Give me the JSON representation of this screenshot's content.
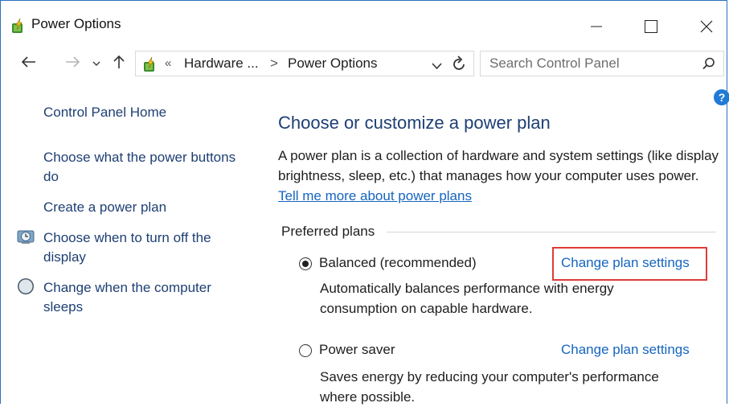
{
  "window": {
    "title": "Power Options",
    "icon": "power-options-icon",
    "controls": [
      "minimize-icon",
      "maximize-icon",
      "close-icon"
    ]
  },
  "nav": {
    "breadcrumb_overflow": "«",
    "breadcrumb": [
      "Hardware ...",
      "Power Options"
    ],
    "separator": ">",
    "search_placeholder": "Search Control Panel"
  },
  "sidebar": {
    "home": "Control Panel Home",
    "links": [
      {
        "label": "Choose what the power buttons do",
        "icon": ""
      },
      {
        "label": "Create a power plan",
        "icon": ""
      },
      {
        "label": "Choose when to turn off the display",
        "icon": "display-timer-icon"
      },
      {
        "label": "Change when the computer sleeps",
        "icon": "sleep-moon-icon"
      }
    ]
  },
  "main": {
    "help": "?",
    "title": "Choose or customize a power plan",
    "description": "A power plan is a collection of hardware and system settings (like display brightness, sleep, etc.) that manages how your computer uses power.",
    "description_link": "Tell me more about power plans",
    "group_label": "Preferred plans",
    "plans": [
      {
        "name": "Balanced (recommended)",
        "selected": true,
        "link": "Change plan settings",
        "description": "Automatically balances performance with energy consumption on capable hardware."
      },
      {
        "name": "Power saver",
        "selected": false,
        "link": "Change plan settings",
        "description": "Saves energy by reducing your computer's performance where possible."
      }
    ]
  },
  "colors": {
    "accent_link": "#1565c0",
    "heading": "#1e3f73",
    "highlight": "#e03a3a",
    "window_border": "#2b6fc2"
  }
}
